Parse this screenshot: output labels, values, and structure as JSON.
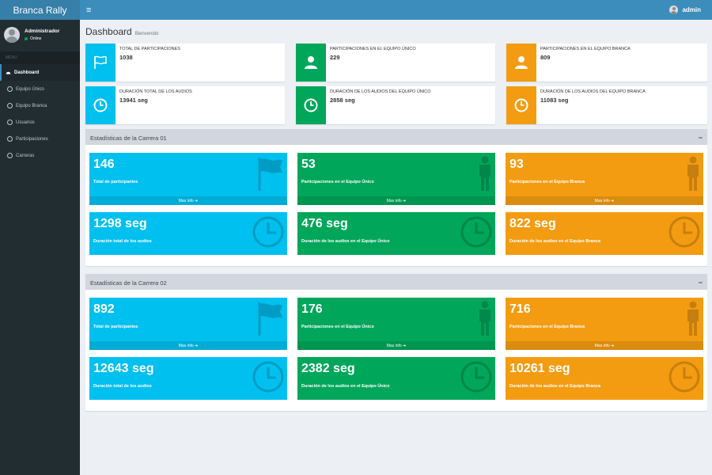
{
  "app": {
    "title": "Branca Rally"
  },
  "header": {
    "user": "admin"
  },
  "sidebar": {
    "user_name": "Administrador",
    "user_status": "Online",
    "menu_header": "MENU",
    "items": [
      {
        "label": "Dashboard",
        "icon": "dashboard-icon"
      },
      {
        "label": "Equipo Único",
        "icon": "circle-icon"
      },
      {
        "label": "Equipo Branca",
        "icon": "circle-icon"
      },
      {
        "label": "Usuarios",
        "icon": "circle-icon"
      },
      {
        "label": "Participaciones",
        "icon": "circle-icon"
      },
      {
        "label": "Carreras",
        "icon": "circle-icon"
      }
    ]
  },
  "page": {
    "title": "Dashboard",
    "subtitle": "Bienvenido"
  },
  "infoboxes": [
    {
      "label": "TOTAL DE PARTICIPACIONES",
      "value": "1038",
      "icon": "flag-icon",
      "color": "#00c0ef"
    },
    {
      "label": "PARTICIPACIONES EN EL EQUIPO ÚNICO",
      "value": "229",
      "icon": "user-icon",
      "color": "#00a65a"
    },
    {
      "label": "PARTICIPACIONES EN EL EQUIPO BRANCA",
      "value": "809",
      "icon": "user-icon",
      "color": "#f39c12"
    },
    {
      "label": "DURACIÓN TOTAL DE LOS AUDIOS",
      "value": "13941 seg",
      "icon": "clock-icon",
      "color": "#00c0ef"
    },
    {
      "label": "DURACIÓN DE LOS AUDIOS DEL EQUIPO ÚNICO",
      "value": "2858 seg",
      "icon": "clock-icon",
      "color": "#00a65a"
    },
    {
      "label": "DURACIÓN DE LOS AUDIOS DEL EQUIPO BRANCA",
      "value": "11083 seg",
      "icon": "clock-icon",
      "color": "#f39c12"
    }
  ],
  "sections": [
    {
      "title": "Estadísticas de la Carrera 01",
      "collapse": "−",
      "boxes": [
        {
          "value": "146",
          "label": "Total de participantes",
          "footer": "Mas info",
          "icon": "flag-icon"
        },
        {
          "value": "53",
          "label": "Participaciones en el Equipo Único",
          "footer": "Mas info",
          "icon": "person-icon"
        },
        {
          "value": "93",
          "label": "Participaciones en el Equipo Branca",
          "footer": "Mas info",
          "icon": "person-icon"
        },
        {
          "value": "1298 seg",
          "label": "Duración total de los audios",
          "icon": "clock-icon"
        },
        {
          "value": "476 seg",
          "label": "Duración de los audios en el Equipo Único",
          "icon": "clock-icon"
        },
        {
          "value": "822 seg",
          "label": "Duración de los audios en el Equipo Branca",
          "icon": "clock-icon"
        }
      ]
    },
    {
      "title": "Estadísticas de la Carrera 02",
      "collapse": "−",
      "boxes": [
        {
          "value": "892",
          "label": "Total de participantes",
          "footer": "Mas info",
          "icon": "flag-icon"
        },
        {
          "value": "176",
          "label": "Participaciones en el Equipo Único",
          "footer": "Mas info",
          "icon": "person-icon"
        },
        {
          "value": "716",
          "label": "Participaciones en el Equipo Branca",
          "footer": "Mas info",
          "icon": "person-icon"
        },
        {
          "value": "12643 seg",
          "label": "Duración total de los audios",
          "icon": "clock-icon"
        },
        {
          "value": "2382 seg",
          "label": "Duración de los audios en el Equipo Único",
          "icon": "clock-icon"
        },
        {
          "value": "10261 seg",
          "label": "Duración de los audios en el Equipo Branca",
          "icon": "clock-icon"
        }
      ]
    }
  ],
  "colors": {
    "aqua": "#00c0ef",
    "green": "#00a65a",
    "yellow": "#f39c12",
    "header": "#3c8dbc",
    "sidebar": "#222d32"
  }
}
